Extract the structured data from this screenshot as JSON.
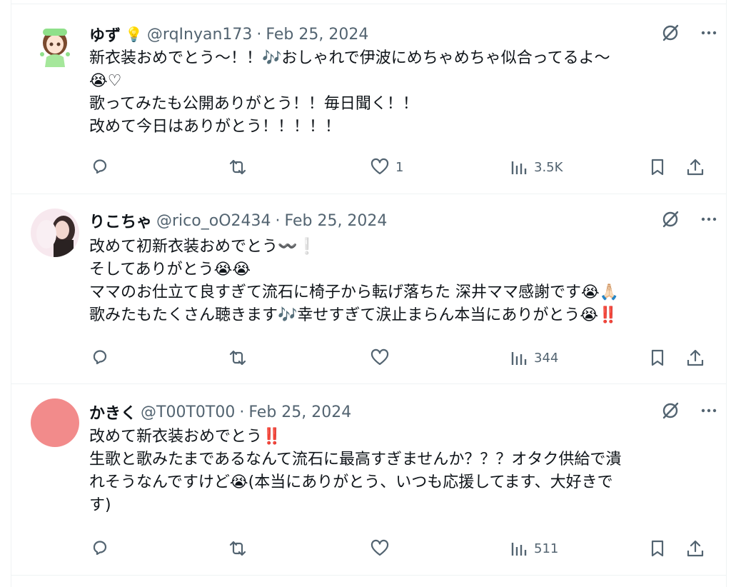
{
  "tweets": [
    {
      "name": "ゆず",
      "name_emoji": "💡",
      "handle": "@rqInyan173",
      "dot": "·",
      "date": "Feb 25, 2024",
      "avatar_color": "#c9f0c5",
      "lines": [
        "新衣装おめでとう〜！！🎶おしゃれで伊波にめちゃめちゃ似合ってるよ〜",
        "😭♡",
        "歌ってみたも公開ありがとう！！毎日聞く！！",
        "改めて今日はありがとう！！！！！"
      ],
      "likes": "1",
      "views": "3.5K"
    },
    {
      "name": "りこちゃ",
      "handle": "@rico_oO2434",
      "dot": "·",
      "date": "Feb 25, 2024",
      "avatar_color": "#f7e8ee",
      "lines": [
        "改めて初新衣装おめでとう〰️❕",
        "そしてありがとう😭😭",
        "ママのお仕立て良すぎて流石に椅子から転げ落ちた 深井ママ感謝です😭🙏🏻",
        "歌みたもたくさん聴きます🎶幸せすぎて涙止まらん本当にありがとう😭‼️"
      ],
      "likes": "",
      "views": "344"
    },
    {
      "name": "かきく",
      "handle": "@T00T0T00",
      "dot": "·",
      "date": "Feb 25, 2024",
      "avatar_color": "#f28b8b",
      "lines": [
        "改めて新衣装おめでとう‼️",
        "生歌と歌みたまであるなんて流石に最高すぎませんか？？？オタク供給で潰",
        "れそうなんですけど😭(本当にありがとう、いつも応援してます、大好きで",
        "す)"
      ],
      "likes": "",
      "views": "511"
    }
  ],
  "icons": {
    "grok": "grok-icon",
    "more": "more-icon",
    "reply": "reply-icon",
    "retweet": "retweet-icon",
    "like": "heart-icon",
    "views": "views-icon",
    "bookmark": "bookmark-icon",
    "share": "share-icon"
  },
  "colors": {
    "text": "#0f1419",
    "secondary": "#536471",
    "border": "#eff3f4",
    "red_mark": "#d62c2c"
  }
}
